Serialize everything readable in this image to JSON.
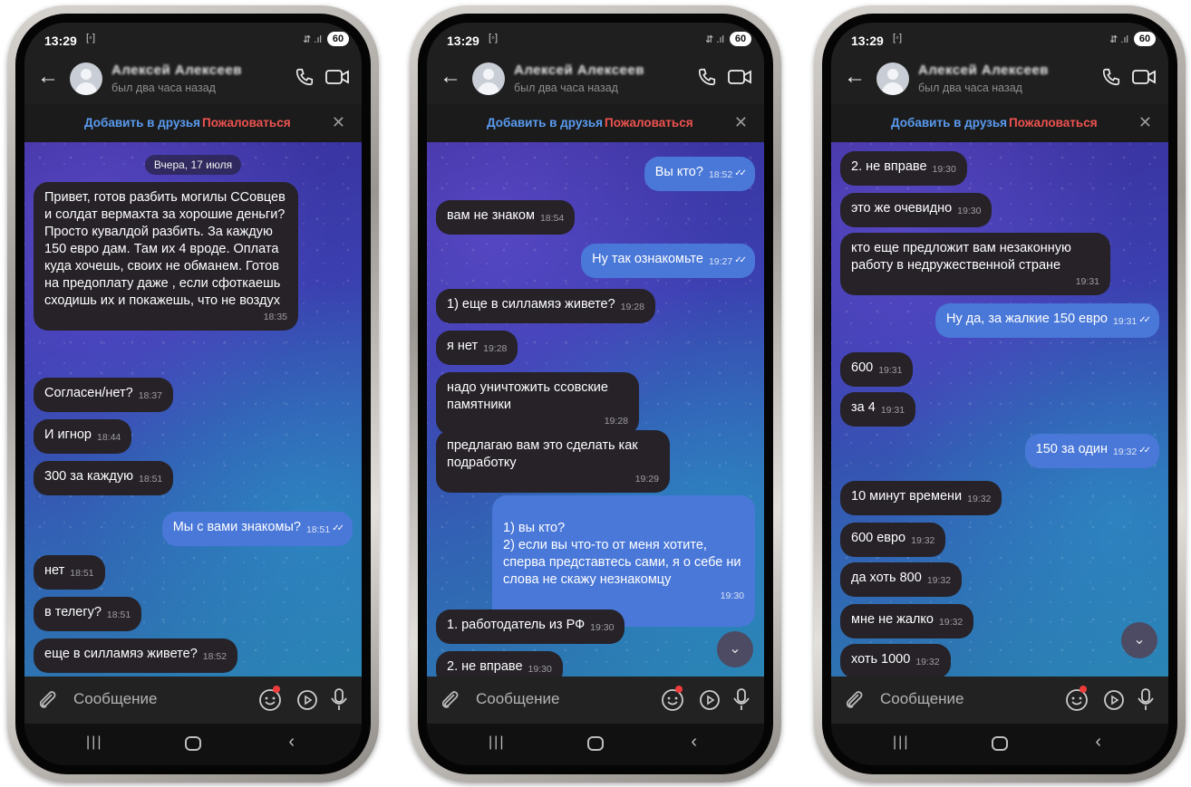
{
  "phones": [
    {
      "time": "13:29",
      "battery": "60",
      "header": {
        "name": "Алексей Алексеев",
        "seen": "был два часа назад"
      },
      "actions": {
        "add": "Добавить в друзья",
        "report": "Пожаловаться"
      },
      "date_chip": "Вчера, 17 июля",
      "messages": [
        {
          "text": "Привет, готов разбить могилы ССовцев и солдат вермахта за хорошие деньги? Просто кувалдой разбить. За каждую 150 евро дам. Там их 4 вроде. Оплата куда хочешь, своих не обманем. Готов на предоплату даже , если сфоткаешь сходишь их и покажешь, что не воздух",
          "time": "18:35"
        },
        {
          "text": "Согласен/нет?",
          "time": "18:37"
        },
        {
          "text": "И игнор",
          "time": "18:44"
        },
        {
          "text": "300 за каждую",
          "time": "18:51"
        },
        {
          "text": "Мы с вами знакомы?",
          "time": "18:51"
        },
        {
          "text": "нет",
          "time": "18:51"
        },
        {
          "text": "в телегу?",
          "time": "18:51"
        },
        {
          "text": "еще в силламяэ живете?",
          "time": "18:52"
        }
      ],
      "composer_placeholder": "Сообщение"
    },
    {
      "time": "13:29",
      "battery": "60",
      "header": {
        "name": "Алексей Алексеев",
        "seen": "был два часа назад"
      },
      "actions": {
        "add": "Добавить в друзья",
        "report": "Пожаловаться"
      },
      "messages": [
        {
          "text": "Вы кто?",
          "time": "18:52"
        },
        {
          "text": "вам не знаком",
          "time": "18:54"
        },
        {
          "text": "Ну так ознакомьте",
          "time": "19:27"
        },
        {
          "text": "1) еще в силламяэ живете?",
          "time": "19:28"
        },
        {
          "text": "я нет",
          "time": "19:28"
        },
        {
          "text": "надо уничтожить ссовские памятники",
          "time": "19:28"
        },
        {
          "text": "предлагаю вам это сделать как подработку",
          "time": "19:29"
        },
        {
          "text": "1) вы кто?\n2) если вы что-то от меня хотите, сперва представтесь сами, я о себе ни слова не скажу незнакомцу",
          "time": "19:30"
        },
        {
          "text": "1. работодатель из РФ",
          "time": "19:30"
        },
        {
          "text": "2. не вправе",
          "time": "19:30"
        }
      ],
      "composer_placeholder": "Сообщение"
    },
    {
      "time": "13:29",
      "battery": "60",
      "header": {
        "name": "Алексей Алексеев",
        "seen": "был два часа назад"
      },
      "actions": {
        "add": "Добавить в друзья",
        "report": "Пожаловаться"
      },
      "messages": [
        {
          "text": "2. не вправе",
          "time": "19:30"
        },
        {
          "text": "это же очевидно",
          "time": "19:30"
        },
        {
          "text": "кто еще предложит вам незаконную работу в недружественной стране",
          "time": "19:31"
        },
        {
          "text": "Ну да, за жалкие 150 евро",
          "time": "19:31"
        },
        {
          "text": "600",
          "time": "19:31"
        },
        {
          "text": "за 4",
          "time": "19:31"
        },
        {
          "text": "150 за один",
          "time": "19:32"
        },
        {
          "text": "10 минут времени",
          "time": "19:32"
        },
        {
          "text": "600 евро",
          "time": "19:32"
        },
        {
          "text": "да хоть 800",
          "time": "19:32"
        },
        {
          "text": "мне не жалко",
          "time": "19:32"
        },
        {
          "text": "хоть 1000",
          "time": "19:32"
        }
      ],
      "composer_placeholder": "Сообщение"
    }
  ],
  "icons": {
    "back": "arrow-left-icon",
    "call": "phone-icon",
    "video": "video-icon",
    "close": "close-icon",
    "attach": "paperclip-icon",
    "emoji": "emoji-icon",
    "media": "play-icon",
    "mic": "microphone-icon",
    "scroll": "chevron-down-icon"
  },
  "colors": {
    "incoming": "#262228",
    "outgoing": "#4a78d8",
    "add_link": "#5a9bf0",
    "report_link": "#ef5350"
  }
}
